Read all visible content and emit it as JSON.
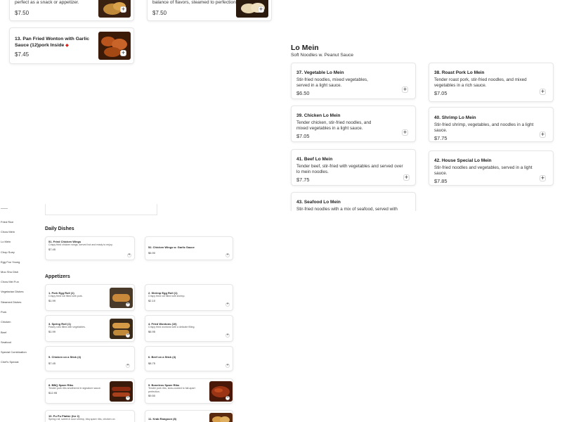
{
  "top_cards": [
    {
      "desc": "Crispy fried pastry filled with flavors, perfect as a snack or appetizer.",
      "price": "$7.50"
    },
    {
      "desc": "Tender dumplings filled with a delicate balance of flavors, steamed to perfection.",
      "price": "$7.50"
    },
    {
      "title": "13. Pan Fried Wonton with Garlic Sauce (12)pork Inside",
      "price": "$7.45"
    }
  ],
  "lo_mein": {
    "title": "Lo Mein",
    "subtitle": "Soft Noodles w. Peanut Sauce",
    "items": [
      {
        "name": "37. Vegetable Lo Mein",
        "desc": "Stir-fried noodles, mixed vegetables, served in a light sauce.",
        "price": "$6.50"
      },
      {
        "name": "38. Roast Pork Lo Mein",
        "desc": "Tender roast pork, stir-fried noodles, and mixed vegetables in a rich sauce.",
        "price": "$7.05"
      },
      {
        "name": "39. Chicken Lo Mein",
        "desc": "Tender chicken, stir-fried noodles, and mixed vegetables in a light sauce.",
        "price": "$7.05"
      },
      {
        "name": "40. Shrimp Lo Mein",
        "desc": "Stir-fried shrimp, vegetables, and noodles in a light sauce.",
        "price": "$7.75"
      },
      {
        "name": "41. Beef Lo Mein",
        "desc": "Tender beef, stir-fried with vegetables and served over lo mein noodles.",
        "price": "$7.75"
      },
      {
        "name": "42. House Special Lo Mein",
        "desc": "Stir-fried noodles and vegetables, served in a light sauce.",
        "price": "$7.85"
      },
      {
        "name": "43. Seafood Lo Mein",
        "desc": "Stir-fried noodles with a mix of seafood, served with"
      }
    ]
  },
  "sidebar": [
    "Fried Rice",
    "Chow Mein",
    "Lo Mein",
    "Chop Suey",
    "Egg Foo Young",
    "Moo Shu Dish",
    "Chow Mei Fun",
    "Vegetarian Dishes",
    "Steamed Dishes",
    "Pork",
    "Chicken",
    "Beef",
    "Seafood",
    "Special Combination",
    "Chef's Special"
  ],
  "daily_dishes": {
    "title": "Daily Dishes",
    "items": [
      {
        "name": "51. Fried Chicken Wings",
        "desc": "Crispy fried chicken wings, served hot and ready to enjoy.",
        "price": "$7.45"
      },
      {
        "name": "52. Chicken Wings w. Garlic Sauce",
        "price": "$6.90"
      }
    ]
  },
  "appetizers": {
    "title": "Appetizers",
    "items": [
      {
        "name": "1. Pork Egg Roll (1)",
        "desc": "Crispy fried roll filled with pork.",
        "price": "$1.99"
      },
      {
        "name": "2. Shrimp Egg Roll (1)",
        "desc": "Crispy fried roll filled with shrimp.",
        "price": "$2.10"
      },
      {
        "name": "3. Spring Roll (1)",
        "desc": "Pastry rolls filled with vegetables.",
        "price": "$1.99"
      },
      {
        "name": "4. Fried Wontons (10)",
        "desc": "Crispy fried wontons with a delicate filling.",
        "price": "$6.95"
      },
      {
        "name": "5. Chicken on a Stick (4)",
        "price": "$7.45"
      },
      {
        "name": "6. Beef on a Stick (4)",
        "price": "$8.75"
      },
      {
        "name": "8. BBQ Spare Ribs",
        "desc": "Tender pork ribs smothered in signature sauce.",
        "price": "$12.95"
      },
      {
        "name": "9. Boneless Spare Ribs",
        "desc": "Tender pork ribs, slow-cooked to fall-apart perfection.",
        "price": "$9.50"
      },
      {
        "name": "10. Pu Pu Platter (for 2)",
        "desc": "Spring roll, sweet & sour shrimp, bbq spare ribs, chicken on"
      },
      {
        "name": "11. Krab Rangoon (8)"
      }
    ]
  },
  "colors": {
    "accent_red": "#d9231d",
    "card_border": "#e6e6e6"
  }
}
